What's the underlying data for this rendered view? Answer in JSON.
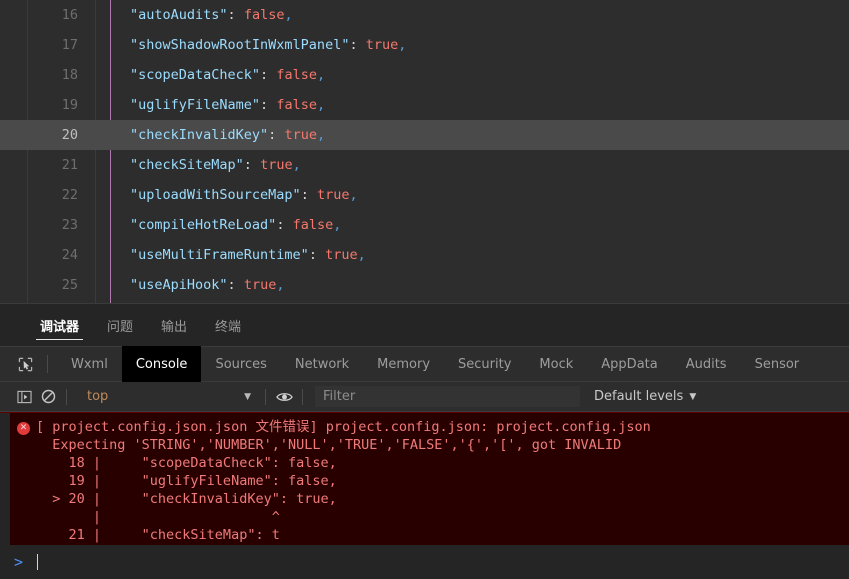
{
  "editor": {
    "active_line": 20,
    "lines": [
      {
        "num": "16",
        "key": "\"autoAudits\"",
        "value": "false",
        "comma": ","
      },
      {
        "num": "17",
        "key": "\"showShadowRootInWxmlPanel\"",
        "value": "true",
        "comma": ","
      },
      {
        "num": "18",
        "key": "\"scopeDataCheck\"",
        "value": "false",
        "comma": ","
      },
      {
        "num": "19",
        "key": "\"uglifyFileName\"",
        "value": "false",
        "comma": ","
      },
      {
        "num": "20",
        "key": "\"checkInvalidKey\"",
        "value": "true",
        "comma": ","
      },
      {
        "num": "21",
        "key": "\"checkSiteMap\"",
        "value": "true",
        "comma": ","
      },
      {
        "num": "22",
        "key": "\"uploadWithSourceMap\"",
        "value": "true",
        "comma": ","
      },
      {
        "num": "23",
        "key": "\"compileHotReLoad\"",
        "value": "false",
        "comma": ","
      },
      {
        "num": "24",
        "key": "\"useMultiFrameRuntime\"",
        "value": "true",
        "comma": ","
      },
      {
        "num": "25",
        "key": "\"useApiHook\"",
        "value": "true",
        "comma": ","
      }
    ],
    "separator": ": "
  },
  "panel": {
    "tabs": [
      {
        "label": "调试器",
        "active": true
      },
      {
        "label": "问题",
        "active": false
      },
      {
        "label": "输出",
        "active": false
      },
      {
        "label": "终端",
        "active": false
      }
    ]
  },
  "devtools": {
    "inspect_icon": "inspect-cursor-icon",
    "tabs": [
      {
        "label": "Wxml",
        "active": false
      },
      {
        "label": "Console",
        "active": true
      },
      {
        "label": "Sources",
        "active": false
      },
      {
        "label": "Network",
        "active": false
      },
      {
        "label": "Memory",
        "active": false
      },
      {
        "label": "Security",
        "active": false
      },
      {
        "label": "Mock",
        "active": false
      },
      {
        "label": "AppData",
        "active": false
      },
      {
        "label": "Audits",
        "active": false
      },
      {
        "label": "Sensor",
        "active": false
      }
    ]
  },
  "console_toolbar": {
    "sidebar_toggle_icon": "console-sidebar-icon",
    "clear_icon": "clear-console-icon",
    "context_value": "top",
    "context_caret": "▼",
    "eye_icon": "eye-icon",
    "filter_placeholder": "Filter",
    "filter_value": "",
    "levels_label": "Default levels",
    "levels_caret": "▼"
  },
  "console_output": {
    "error": {
      "icon_glyph": "✕",
      "icon_name": "error-icon",
      "color": "#f07a7a",
      "background": "#290000",
      "text": "[ project.config.json.json 文件错误] project.config.json: project.config.json\n  Expecting 'STRING','NUMBER','NULL','TRUE','FALSE','{','[', got INVALID\n    18 |     \"scopeDataCheck\": false,\n    19 |     \"uglifyFileName\": false,\n  > 20 |     \"checkInvalidKey\": true,\n       |                     ^\n    21 |     \"checkSiteMap\": t"
    }
  },
  "console_input": {
    "prompt": ">",
    "value": ""
  },
  "colors": {
    "editor_bg": "#2d2d2d",
    "active_line": "#4a4a4a",
    "panel_bg": "#252526",
    "key": "#9cdcfe",
    "bool": "#f4786d",
    "error_bg": "#290000",
    "error_text": "#f07a7a",
    "prompt_blue": "#4f8ff7",
    "indent_guide": "#b07ab0",
    "context_orange": "#c08a5a"
  }
}
